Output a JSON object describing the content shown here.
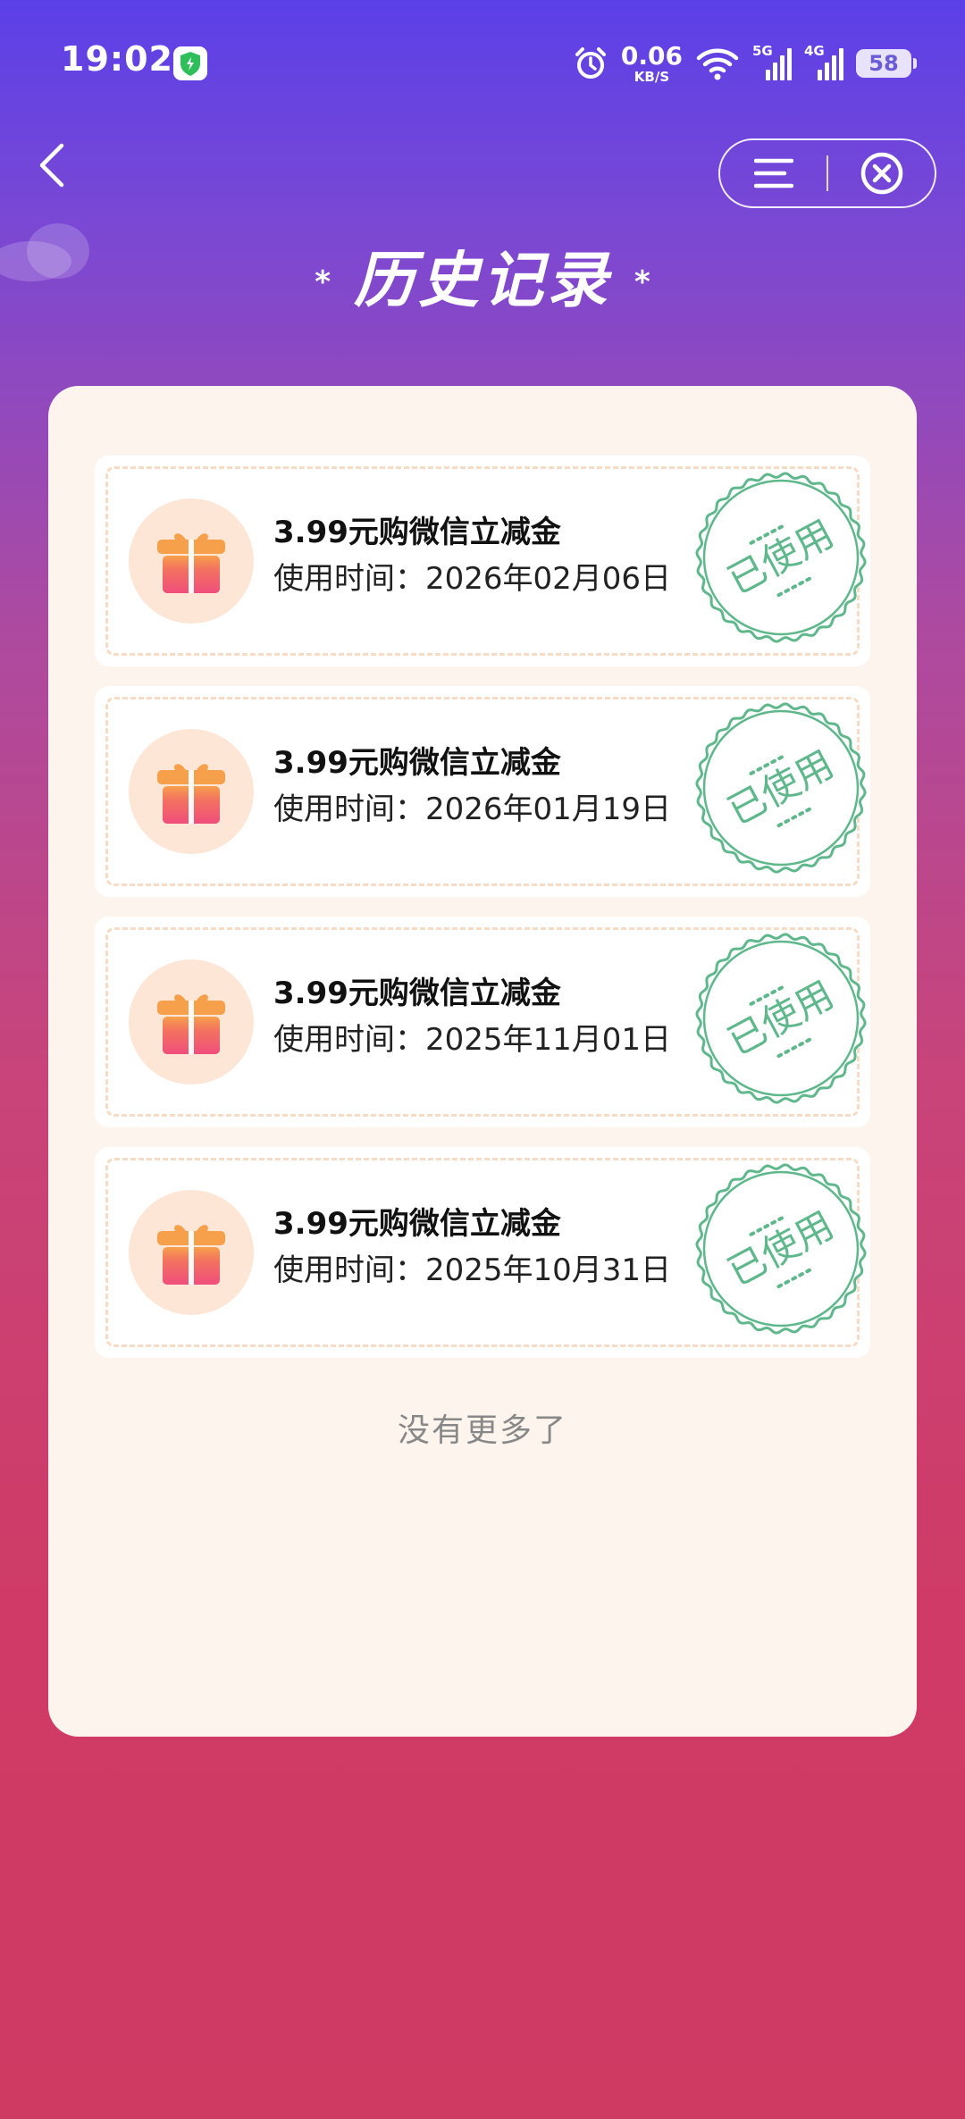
{
  "status_bar": {
    "time": "19:02",
    "net_speed_value": "0.06",
    "net_speed_unit": "KB/S",
    "signal_1_label": "5G",
    "signal_2_label": "4G",
    "battery": "58"
  },
  "header": {
    "title": "历史记录",
    "star_left": "*",
    "star_right": "*"
  },
  "colors": {
    "accent_green": "#5fb88b",
    "gift_orange": "#f7a04b",
    "gift_pink": "#f04e7a",
    "card_bg": "#fdf5ed"
  },
  "records": [
    {
      "title": "3.99元购微信立减金",
      "time": "使用时间：2026年02月06日",
      "stamp": "已使用"
    },
    {
      "title": "3.99元购微信立减金",
      "time": "使用时间：2026年01月19日",
      "stamp": "已使用"
    },
    {
      "title": "3.99元购微信立减金",
      "time": "使用时间：2025年11月01日",
      "stamp": "已使用"
    },
    {
      "title": "3.99元购微信立减金",
      "time": "使用时间：2025年10月31日",
      "stamp": "已使用"
    }
  ],
  "footer": {
    "no_more": "没有更多了"
  }
}
